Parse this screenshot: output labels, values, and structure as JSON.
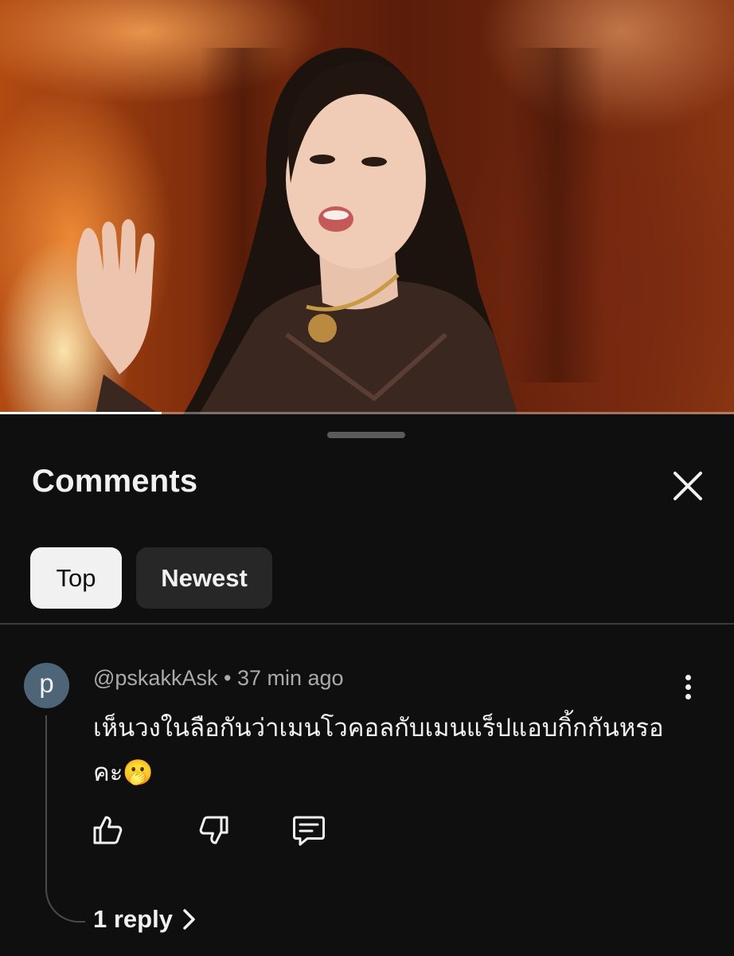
{
  "video": {
    "progress": 0.22
  },
  "comments_panel": {
    "title": "Comments",
    "close_icon": "close-icon",
    "filters": [
      {
        "label": "Top",
        "selected": true
      },
      {
        "label": "Newest",
        "selected": false
      }
    ]
  },
  "comment": {
    "avatar_letter": "p",
    "avatar_color": "#4e6577",
    "author": "@pskakkAsk",
    "separator": "•",
    "time_ago": "37 min ago",
    "text": "เห็นวงในลือกันว่าเมนโวคอลกับเมนแร็ปแอบกิ้กกันหรอคะ🫢",
    "replies_label": "1 reply"
  },
  "colors": {
    "background": "#0f0f0f",
    "chip_active_bg": "#f1f1f1",
    "chip_inactive_bg": "#272727",
    "secondary_text": "#aaaaaa"
  }
}
